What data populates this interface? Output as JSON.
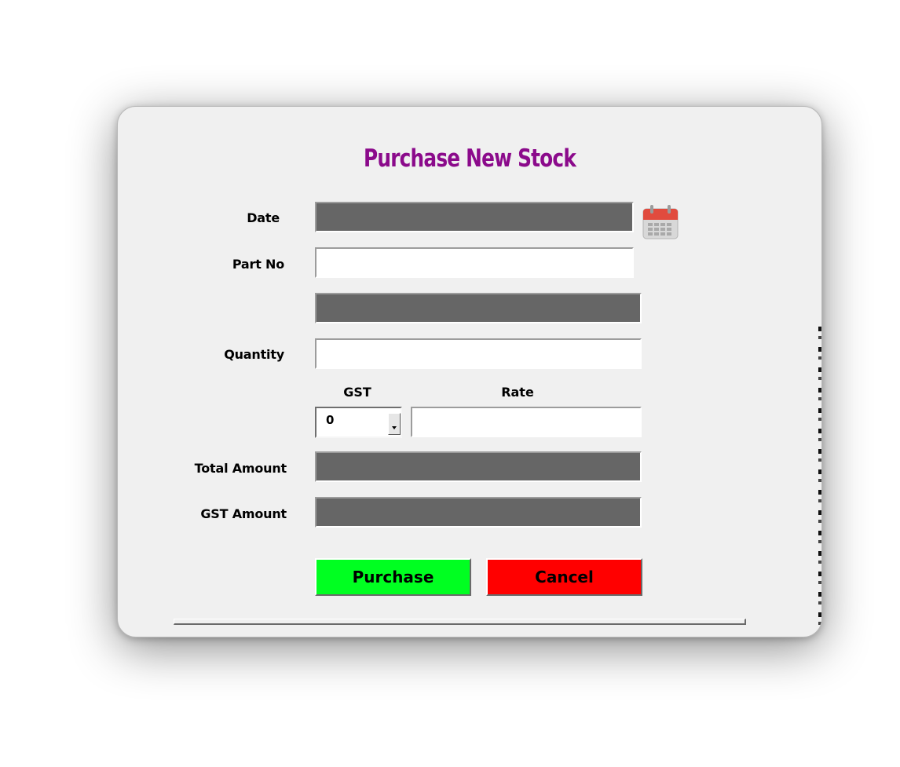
{
  "dialog": {
    "title": "Purchase New Stock"
  },
  "fields": {
    "date_label": "Date",
    "date_value": "",
    "part_no_label": "Part No",
    "part_no_value": "",
    "description_value": "",
    "quantity_label": "Quantity",
    "quantity_value": "",
    "gst_header": "GST",
    "gst_selected": "0",
    "rate_header": "Rate",
    "rate_value": "",
    "total_amount_label": "Total Amount",
    "total_amount_value": "",
    "gst_amount_label": "GST Amount",
    "gst_amount_value": ""
  },
  "buttons": {
    "purchase_label": "Purchase",
    "cancel_label": "Cancel"
  },
  "colors": {
    "title": "#8b0a8b",
    "purchase_button": "#00ff21",
    "cancel_button": "#ff0000",
    "readonly_field": "#666666",
    "dialog_background": "#f0f0f0"
  },
  "icons": {
    "date_picker": "calendar-icon",
    "gst_dropdown": "chevron-down-icon"
  }
}
